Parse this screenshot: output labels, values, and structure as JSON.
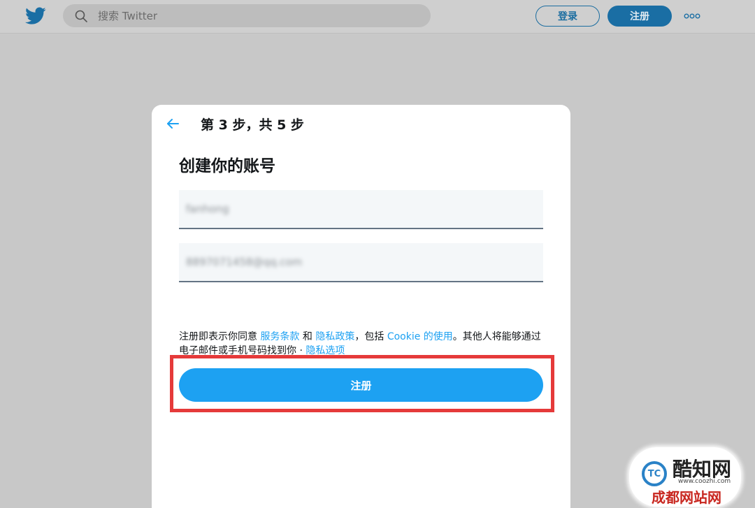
{
  "header": {
    "search_placeholder": "搜索 Twitter",
    "login_label": "登录",
    "signup_label": "注册",
    "more_icon": "more-horizontal-icon"
  },
  "modal": {
    "step": "第 3 步，共 5 步",
    "title": "创建你的账号",
    "name_value": "fanhong",
    "email_value": "8897071458@qq.com",
    "terms": {
      "prefix": "注册即表示你同意 ",
      "tos": "服务条款",
      "and": " 和 ",
      "privacy": "隐私政策",
      "mid": "，包括 ",
      "cookie": "Cookie 的使用",
      "suffix": "。其他人将能够通过电子邮件或手机号码找到你 · ",
      "privacy_options": "隐私选项"
    },
    "submit_label": "注册"
  },
  "watermark": {
    "logo_text": "TC",
    "name": "酷知网",
    "url": "www.coozhi.com",
    "sub": "成都网站网"
  },
  "colors": {
    "brand": "#1da1f2",
    "highlight": "#e53a3a"
  }
}
